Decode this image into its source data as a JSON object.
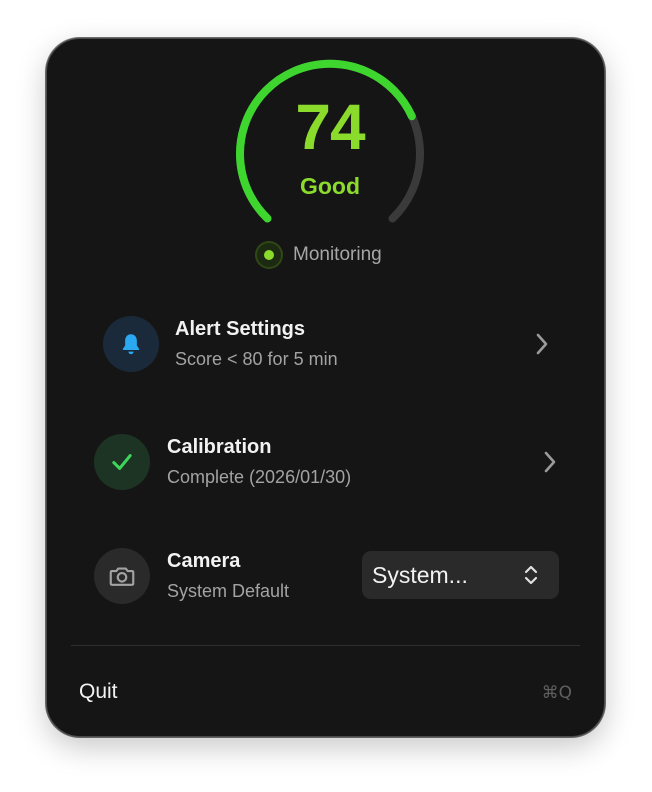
{
  "gauge": {
    "score": "74",
    "label": "Good",
    "fraction": 0.74,
    "accent_color": "#8bdb2d",
    "arc_color": "#3ed62e",
    "track_color": "#3a3a3a"
  },
  "status": {
    "text": "Monitoring",
    "dot_color": "#8bdb2d"
  },
  "rows": [
    {
      "title": "Alert Settings",
      "subtitle": "Score < 80 for 5 min",
      "icon": "bell-icon",
      "icon_color": "#2ba8f2",
      "icon_bg": "#1b2a3a"
    },
    {
      "title": "Calibration",
      "subtitle": "Complete (2026/01/30)",
      "icon": "checkmark-icon",
      "icon_color": "#3ed65a",
      "icon_bg": "#1d3323"
    },
    {
      "title": "Camera",
      "subtitle": "System Default",
      "icon": "camera-icon",
      "icon_color": "#a3a3a3",
      "icon_bg": "#2a2a2a"
    }
  ],
  "camera_select": {
    "value": "System..."
  },
  "footer": {
    "quit_label": "Quit",
    "shortcut": "⌘Q"
  }
}
